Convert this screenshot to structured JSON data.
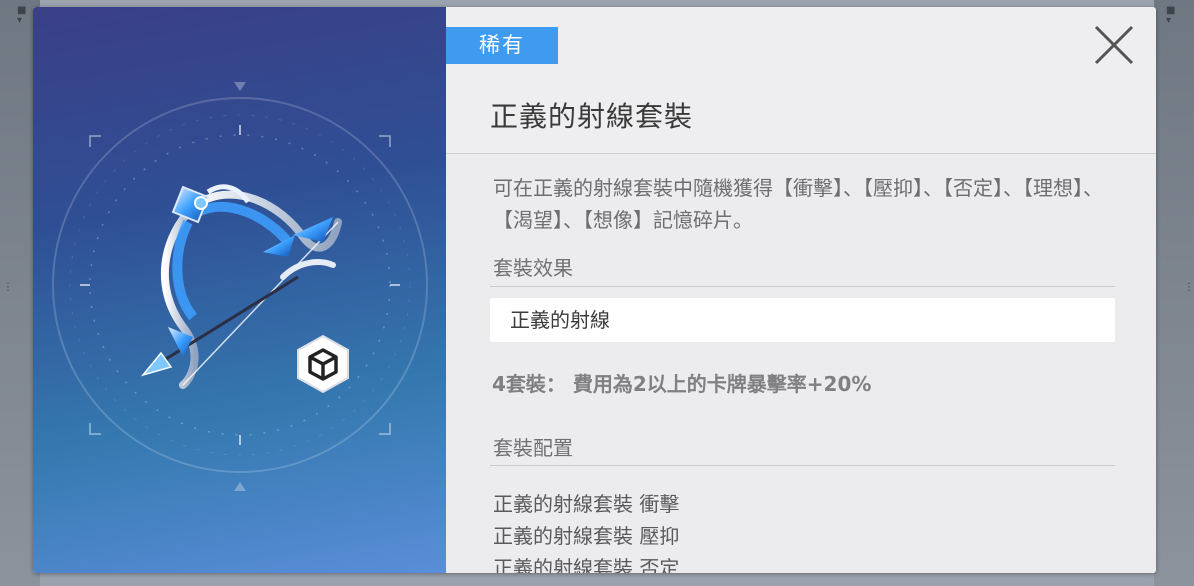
{
  "item": {
    "rarity": "稀有",
    "title": "正義的射線套裝",
    "description": "可在正義的射線套裝中隨機獲得【衝擊】、【壓抑】、【否定】、【理想】、【渴望】、【想像】記憶碎片。",
    "set_effect_label": "套裝效果",
    "set_effect_name": "正義的射線",
    "set_bonus": "4套裝： 費用為2以上的卡牌暴擊率+20%",
    "set_config_label": "套裝配置",
    "set_config_items": [
      "正義的射線套裝 衝擊",
      "正義的射線套裝 壓抑",
      "正義的射線套裝 否定"
    ]
  },
  "icons": {
    "close": "close-icon",
    "weapon": "bow-icon",
    "type": "cube-icon"
  },
  "colors": {
    "rarity_badge": "#3f9bf0",
    "art_top": "#3a3f86",
    "art_bottom": "#5a8ed8"
  }
}
